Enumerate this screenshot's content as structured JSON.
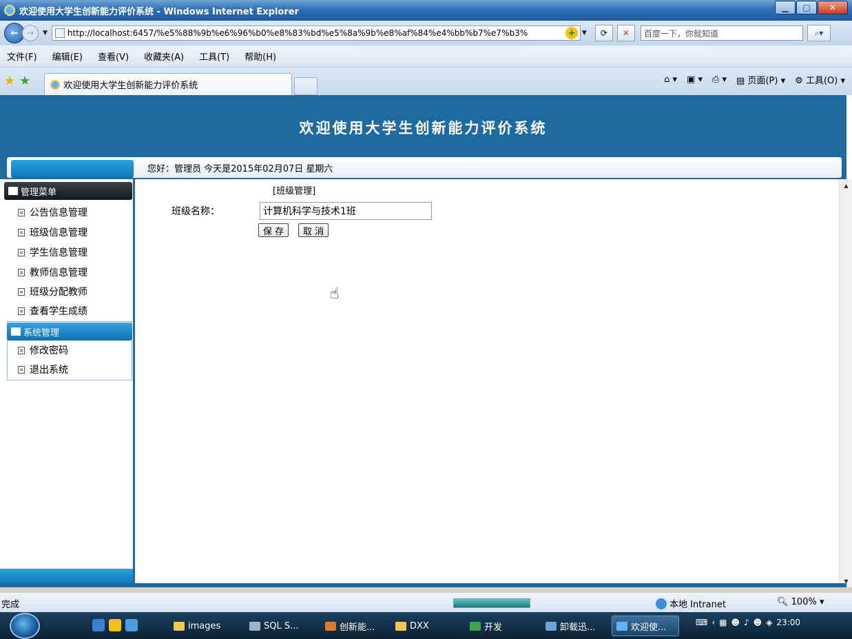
{
  "window": {
    "title": "欢迎使用大学生创新能力评价系统 - Windows Internet Explorer"
  },
  "address": {
    "url": "http://localhost:6457/%e5%88%9b%e6%96%b0%e8%83%bd%e5%8a%9b%e8%af%84%e4%bb%b7%e7%b3%",
    "search_placeholder": "百度一下，你就知道"
  },
  "menubar": {
    "items": [
      "文件(F)",
      "编辑(E)",
      "查看(V)",
      "收藏夹(A)",
      "工具(T)",
      "帮助(H)"
    ]
  },
  "tabs": {
    "active_label": "欢迎使用大学生创新能力评价系统"
  },
  "commandbar": {
    "page_label": "页面(P)",
    "tools_label": "工具(O)"
  },
  "page": {
    "banner_title": "欢迎使用大学生创新能力评价系统",
    "greeting": "您好：管理员   今天是2015年02月07日   星期六"
  },
  "sidebar": {
    "main_menu_title": "管理菜单",
    "main_items": [
      "公告信息管理",
      "班级信息管理",
      "学生信息管理",
      "教师信息管理",
      "班级分配教师",
      "查看学生成绩"
    ],
    "system_menu_title": "系统管理",
    "system_items": [
      "修改密码",
      "退出系统"
    ]
  },
  "form": {
    "title": "[班级管理]",
    "class_name_label": "班级名称：",
    "class_name_value": "计算机科学与技术1班",
    "save_label": "保 存",
    "cancel_label": "取 消"
  },
  "statusbar": {
    "status": "完成",
    "zone": "本地 Intranet",
    "zoom": "100%",
    "progress": 1.0
  },
  "taskbar": {
    "tasks": [
      "images",
      "SQL S...",
      "创新能...",
      "DXX",
      "开发",
      "卸载迅...",
      "欢迎使..."
    ],
    "time": "23:00"
  },
  "colors": {
    "banner": "#1f6aa0",
    "titlebar": "#2f6fb4"
  }
}
